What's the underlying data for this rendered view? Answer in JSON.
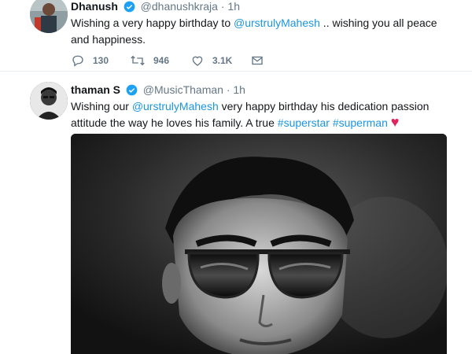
{
  "tweets": [
    {
      "name": "Dhanush",
      "handle": "@dhanushkraja",
      "separator": "·",
      "time": "1h",
      "text": {
        "t1": "Wishing a very happy birthday to ",
        "mention": "@urstrulyMahesh",
        "t2": " .. wishing you all peace and happiness."
      },
      "actions": {
        "replies": "130",
        "retweets": "946",
        "likes": "3.1K"
      }
    },
    {
      "name": "thaman S",
      "handle": "@MusicThaman",
      "separator": "·",
      "time": "1h",
      "text": {
        "t1": "Wishing our ",
        "mention": "@urstrulyMahesh",
        "t2": " very happy birthday his dedication passion attitude the way he loves his family. A true ",
        "hashtag1": "#superstar",
        "hashtag2": "#superman",
        "emoji": "♥"
      }
    }
  ],
  "colors": {
    "link": "#1b95e0",
    "verified": "#1da1f2",
    "muted": "#657786",
    "heart": "#e0245e"
  },
  "icons": [
    "verified-badge-icon",
    "reply-icon",
    "retweet-icon",
    "like-icon",
    "direct-message-icon"
  ]
}
